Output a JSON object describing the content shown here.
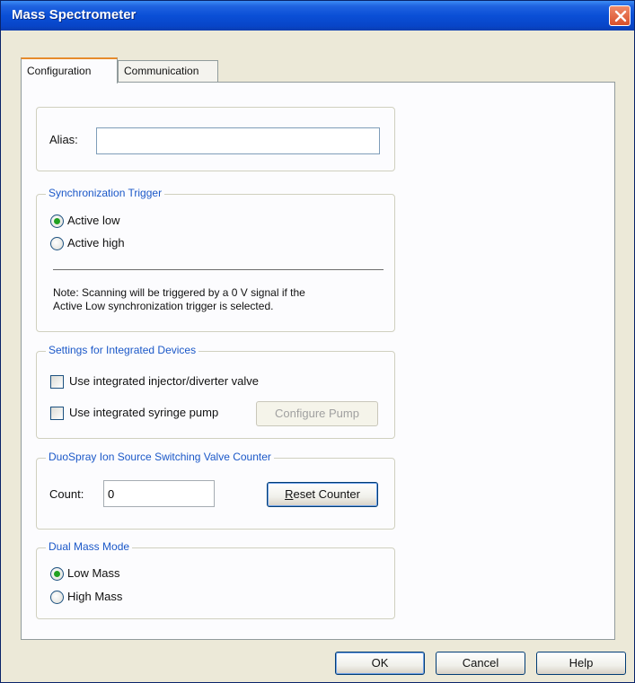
{
  "window": {
    "title": "Mass Spectrometer"
  },
  "tabs": [
    {
      "label": "Configuration",
      "active": true
    },
    {
      "label": "Communication",
      "active": false
    }
  ],
  "alias": {
    "label": "Alias:",
    "value": ""
  },
  "sync_trigger": {
    "title": "Synchronization Trigger",
    "options": [
      {
        "label": "Active low",
        "checked": true
      },
      {
        "label": "Active high",
        "checked": false
      }
    ],
    "note_line1": "Note:  Scanning will be triggered by a 0 V signal if the",
    "note_line2": "Active Low synchronization trigger is selected."
  },
  "integrated_devices": {
    "title": "Settings for Integrated Devices",
    "valve_label": "Use integrated injector/diverter valve",
    "pump_label": "Use integrated syringe pump",
    "configure_pump_label": "Configure Pump"
  },
  "valve_counter": {
    "title": "DuoSpray Ion Source Switching Valve Counter",
    "count_label": "Count:",
    "count_value": "0",
    "reset_label": "Reset Counter"
  },
  "dual_mass": {
    "title": "Dual Mass Mode",
    "options": [
      {
        "label": "Low Mass",
        "checked": true
      },
      {
        "label": "High Mass",
        "checked": false
      }
    ]
  },
  "footer": {
    "ok_label": "OK",
    "cancel_label": "Cancel",
    "help_label": "Help"
  }
}
